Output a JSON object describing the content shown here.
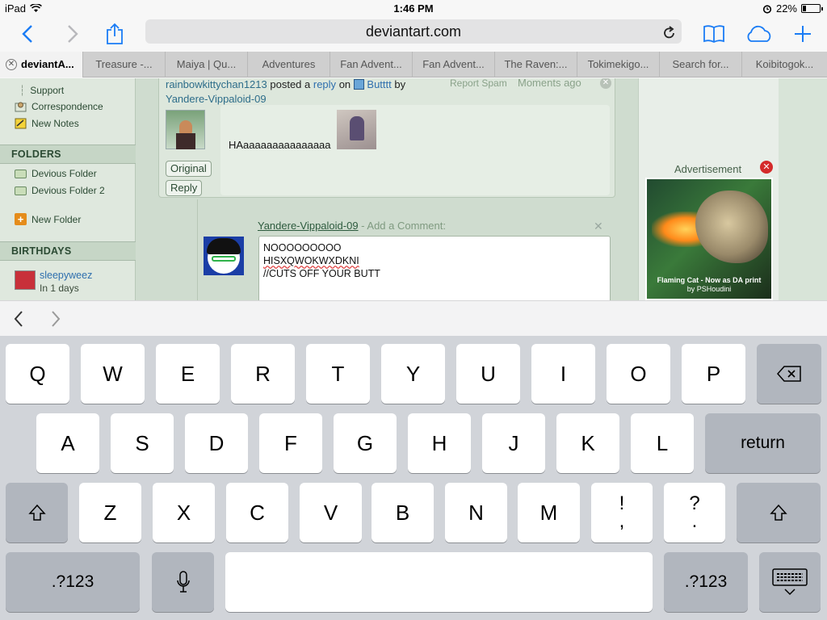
{
  "status_bar": {
    "device": "iPad",
    "time": "1:46 PM",
    "battery": "22%",
    "battery_level": 0.22
  },
  "toolbar": {
    "url": "deviantart.com"
  },
  "tabs": [
    {
      "label": "deviantA..."
    },
    {
      "label": "Treasure -..."
    },
    {
      "label": "Maiya | Qu..."
    },
    {
      "label": "Adventures"
    },
    {
      "label": "Fan Advent..."
    },
    {
      "label": "Fan Advent..."
    },
    {
      "label": "The Raven:..."
    },
    {
      "label": "Tokimekigo..."
    },
    {
      "label": "Search for..."
    },
    {
      "label": "Koibitogok..."
    }
  ],
  "sidebar": {
    "support": "Support",
    "correspondence": "Correspondence",
    "new_notes": "New Notes",
    "folders_header": "FOLDERS",
    "folder1": "Devious Folder",
    "folder2": "Devious Folder 2",
    "new_folder": "New Folder",
    "birthdays_header": "BIRTHDAYS",
    "birthday_user": "sleepyweez",
    "birthday_when": "In 1 days"
  },
  "comment": {
    "author": "rainbowkittychan1213",
    "posted_a": "posted a",
    "reply": "reply",
    "on": "on",
    "deviation": "Butttt",
    "by": "by",
    "target_user": "Yandere-Vippaloid-09",
    "report": "Report Spam",
    "time": "Moments ago",
    "text": "HAaaaaaaaaaaaaaaa",
    "original_btn": "Original",
    "reply_btn": "Reply"
  },
  "reply_form": {
    "user": "Yandere-Vippaloid-09",
    "separator": " - ",
    "prompt": "Add a Comment:",
    "line1": "NOOOOOOOOO",
    "line2": "HISXQWOKWXDKNI",
    "line3": "//CUTS OFF YOUR BUTT"
  },
  "ad": {
    "label": "Advertisement",
    "caption1": "Flaming Cat - Now as DA print",
    "caption2": "by PSHoudini"
  },
  "keyboard": {
    "row1": [
      "Q",
      "W",
      "E",
      "R",
      "T",
      "Y",
      "U",
      "I",
      "O",
      "P"
    ],
    "row2": [
      "A",
      "S",
      "D",
      "F",
      "G",
      "H",
      "J",
      "K",
      "L"
    ],
    "row3": [
      "Z",
      "X",
      "C",
      "V",
      "B",
      "N",
      "M"
    ],
    "return": "return",
    "numbers": ".?123",
    "excl": "!",
    "comma": ",",
    "question": "?",
    "period": "."
  }
}
